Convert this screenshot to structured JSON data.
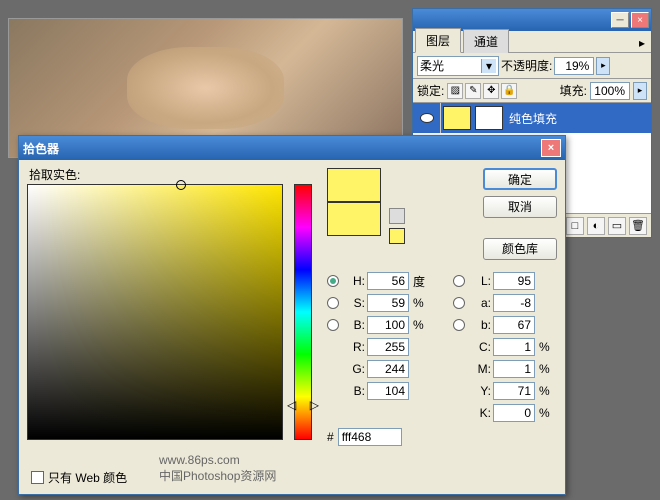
{
  "layers_panel": {
    "tabs": {
      "layers": "图层",
      "channels": "通道"
    },
    "minimize_glyph": "─",
    "close_glyph": "×",
    "menu_glyph": "▸",
    "blend_mode": "柔光",
    "opacity_label": "不透明度:",
    "opacity_value": "19%",
    "lock_label": "锁定:",
    "fill_label": "填充:",
    "fill_value": "100%",
    "lock_icons": [
      "▨",
      "✎",
      "✥",
      "🔒"
    ],
    "layer": {
      "name": "纯色填充"
    },
    "arrow": "▸",
    "bottom_icons": [
      "ⓕ",
      "□",
      "◐",
      "▭",
      "🗑"
    ]
  },
  "picker": {
    "title": "拾色器",
    "close_glyph": "×",
    "pick_label": "拾取实色:",
    "btn_ok": "确定",
    "btn_cancel": "取消",
    "btn_library": "颜色库",
    "web_only": "只有 Web 颜色",
    "hue_left": "◁",
    "hue_right": "▷",
    "swatch_new": "#fff468",
    "swatch_prev": "#fff468",
    "fields": {
      "H": {
        "label": "H:",
        "value": "56",
        "unit": "度",
        "radio": true
      },
      "S": {
        "label": "S:",
        "value": "59",
        "unit": "%",
        "radio": false
      },
      "B": {
        "label": "B:",
        "value": "100",
        "unit": "%",
        "radio": false
      },
      "L": {
        "label": "L:",
        "value": "95",
        "unit": "",
        "radio": false
      },
      "a": {
        "label": "a:",
        "value": "-8",
        "unit": "",
        "radio": false
      },
      "b2": {
        "label": "b:",
        "value": "67",
        "unit": "",
        "radio": false
      },
      "R": {
        "label": "R:",
        "value": "255"
      },
      "G": {
        "label": "G:",
        "value": "244"
      },
      "Bc": {
        "label": "B:",
        "value": "104"
      },
      "C": {
        "label": "C:",
        "value": "1",
        "unit": "%"
      },
      "M": {
        "label": "M:",
        "value": "1",
        "unit": "%"
      },
      "Y": {
        "label": "Y:",
        "value": "71",
        "unit": "%"
      },
      "K": {
        "label": "K:",
        "value": "0",
        "unit": "%"
      }
    },
    "hex_label": "#",
    "hex_value": "fff468",
    "watermark1": "www.86ps.com",
    "watermark2": "中国Photoshop资源网"
  }
}
